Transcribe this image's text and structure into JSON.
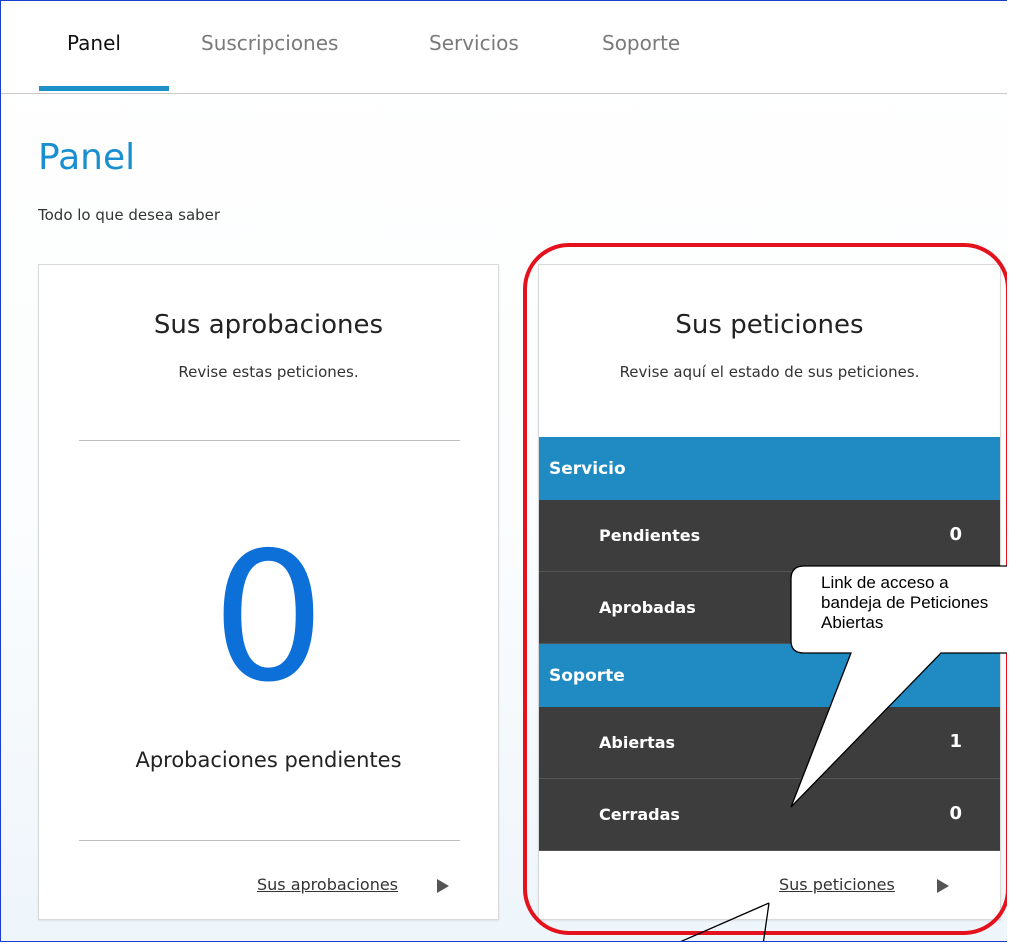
{
  "tabs": [
    {
      "label": "Panel",
      "active": true
    },
    {
      "label": "Suscripciones",
      "active": false
    },
    {
      "label": "Servicios",
      "active": false
    },
    {
      "label": "Soporte",
      "active": false
    }
  ],
  "header": {
    "title": "Panel",
    "subtitle": "Todo lo que desea saber"
  },
  "approvals_card": {
    "title": "Sus aprobaciones",
    "subtitle": "Revise estas peticiones.",
    "count": "0",
    "count_label": "Aprobaciones pendientes",
    "link_label": "Sus aprobaciones"
  },
  "requests_card": {
    "title": "Sus peticiones",
    "subtitle": "Revise aquí el estado de sus peticiones.",
    "groups": [
      {
        "name": "Servicio",
        "rows": [
          {
            "label": "Pendientes",
            "value": "0"
          },
          {
            "label": "Aprobadas",
            "value": ""
          }
        ]
      },
      {
        "name": "Soporte",
        "rows": [
          {
            "label": "Abiertas",
            "value": "1"
          },
          {
            "label": "Cerradas",
            "value": "0"
          }
        ]
      }
    ],
    "link_label": "Sus peticiones"
  },
  "callout": {
    "text": "Link de acceso a\nbandeja de Peticiones\nAbiertas"
  },
  "colors": {
    "accent": "#1e90c8",
    "big_number": "#0d6fd8",
    "table_header": "#1f8bc2",
    "table_row": "#3d3d3d",
    "highlight": "#e3121c"
  }
}
